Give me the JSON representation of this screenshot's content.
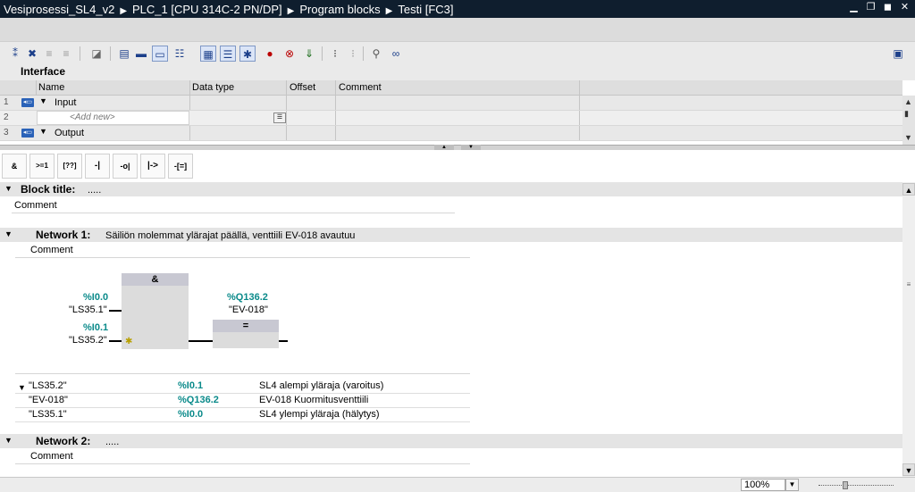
{
  "window": {
    "breadcrumb": [
      "Vesiprosessi_SL4_v2",
      "PLC_1 [CPU 314C-2 PN/DP]",
      "Program blocks",
      "Testi [FC3]"
    ],
    "buttons": [
      "minimize-icon",
      "restore-icon",
      "maximize-icon",
      "close-icon"
    ]
  },
  "toolbar": {
    "icons": [
      "insert-network-icon",
      "delete-network-icon",
      "insert-row-icon",
      "add-row-icon",
      "goto-icon",
      "show-absolute-icon",
      "show-symbolic-icon",
      "comments-toggle-icon",
      "favorites-icon",
      "absolute-operands-icon",
      "network-overview-icon",
      "open-all-networks-icon",
      "set-breakpoint-icon",
      "delete-breakpoint-icon",
      "download-icon",
      "indent-icon",
      "outdent-icon",
      "monitor-icon",
      "glasses-icon",
      "panel-toggle-icon"
    ]
  },
  "interface": {
    "title": "Interface",
    "columns": [
      "Name",
      "Data type",
      "Offset",
      "Comment"
    ],
    "rows": [
      {
        "num": "1",
        "name": "Input",
        "expanded": true
      },
      {
        "num": "2",
        "name": "<Add new>"
      },
      {
        "num": "3",
        "name": "Output",
        "expanded": true
      }
    ]
  },
  "instructions": [
    "&",
    ">=1",
    "[??]",
    "-|",
    "-o|",
    "|->",
    "-[=]"
  ],
  "block": {
    "title_label": "Block title:",
    "title_value": ".....",
    "comment": "Comment"
  },
  "networks": [
    {
      "label": "Network 1:",
      "title": "Säiliön molemmat ylärajat päällä, venttiili EV-018 avautuu",
      "comment": "Comment",
      "and_box_label": "&",
      "assign_box_label": "=",
      "inputs": [
        {
          "address": "%I0.0",
          "tag": "\"LS35.1\""
        },
        {
          "address": "%I0.1",
          "tag": "\"LS35.2\""
        }
      ],
      "output": {
        "address": "%Q136.2",
        "tag": "\"EV-018\""
      },
      "tag_table": [
        {
          "tag": "\"LS35.2\"",
          "address": "%I0.1",
          "comment": "SL4 alempi yläraja (varoitus)"
        },
        {
          "tag": "\"EV-018\"",
          "address": "%Q136.2",
          "comment": "EV-018 Kuormitusventtiili"
        },
        {
          "tag": "\"LS35.1\"",
          "address": "%I0.0",
          "comment": "SL4 ylempi yläraja (hälytys)"
        }
      ]
    },
    {
      "label": "Network 2:",
      "title": ".....",
      "comment": "Comment"
    }
  ],
  "status": {
    "zoom": "100%"
  },
  "colors": {
    "title_bar": "#0f1e2e",
    "address_teal": "#0a8a8a",
    "section_bar": "#e4e4e4",
    "and_box": "#dcdcdc"
  }
}
